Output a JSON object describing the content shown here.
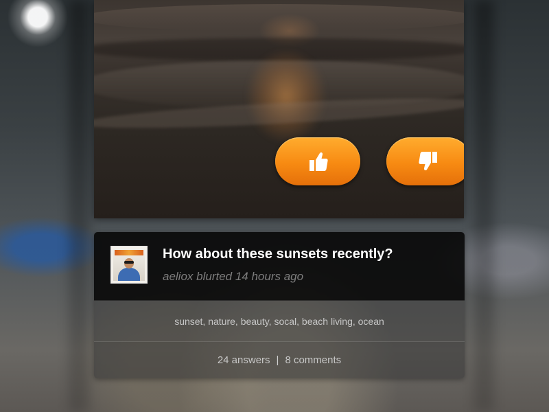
{
  "post": {
    "question": "How about these sunsets recently?",
    "byline": "aeliox blurted 14 hours ago",
    "tags": "sunset, nature, beauty, socal, beach living, ocean",
    "stats": {
      "answers": "24 answers",
      "separator": "|",
      "comments": "8 comments"
    }
  },
  "actions": {
    "like_icon": "thumbs-up-icon",
    "dislike_icon": "thumbs-down-icon"
  },
  "colors": {
    "accent": "#f78a12",
    "card_header": "#0a0a0a",
    "title_text": "#ffffff",
    "byline_text": "#7d7d7d"
  }
}
